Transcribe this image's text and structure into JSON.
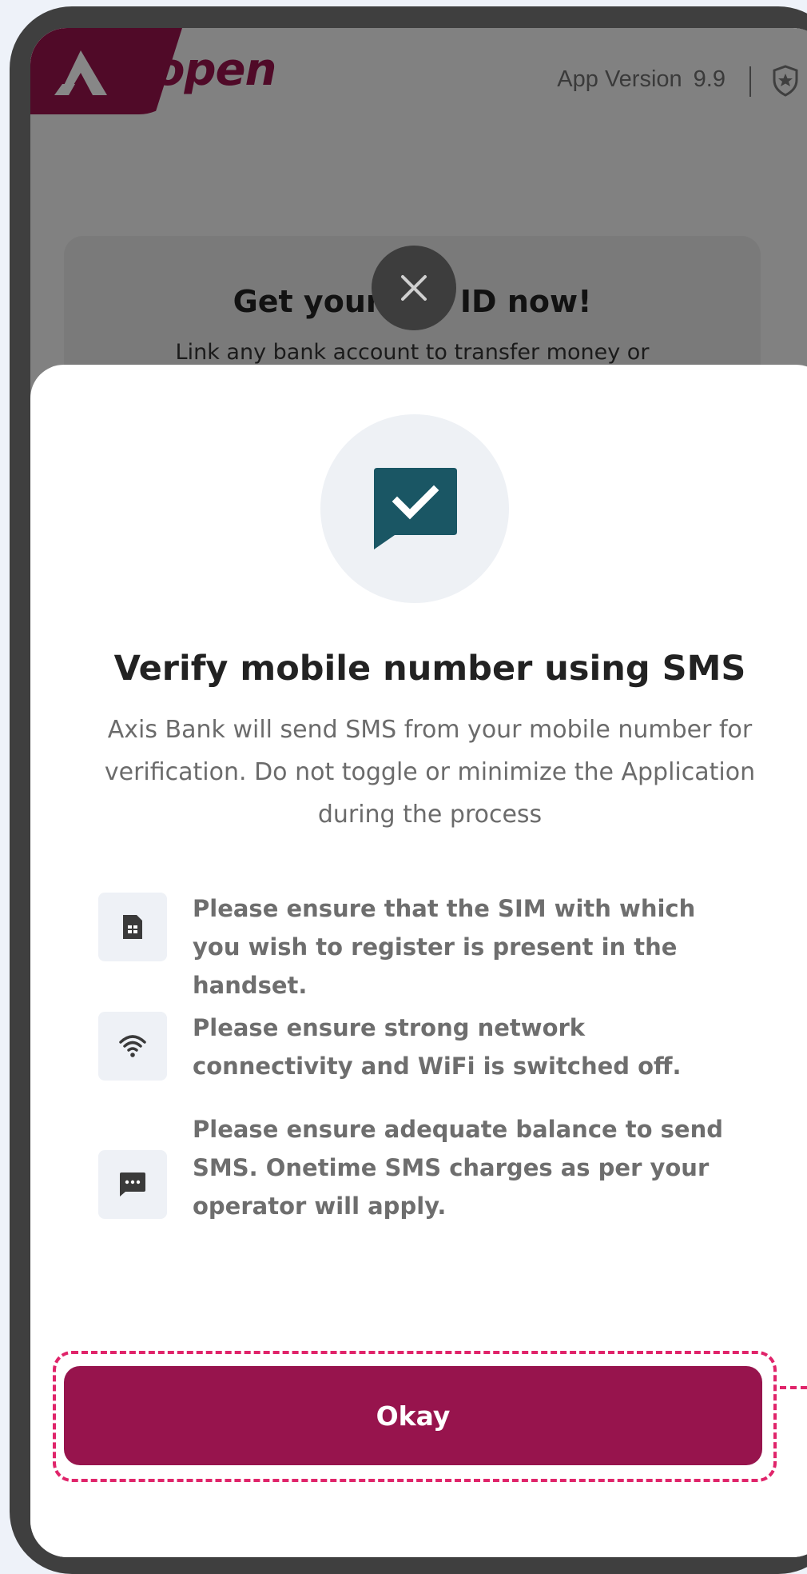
{
  "header": {
    "brand": "open",
    "app_version_label": "App Version",
    "app_version_value": "9.9"
  },
  "background_card": {
    "title": "Get your UPI ID now!",
    "subtitle": "Link any bank account to transfer money or"
  },
  "sheet": {
    "title": "Verify mobile number using SMS",
    "description": "Axis Bank will send SMS from your mobile number for verification. Do not toggle or minimize the Application during the process",
    "items": [
      {
        "icon": "sim-card-icon",
        "text": "Please ensure that the SIM with which you wish to register is present in the handset."
      },
      {
        "icon": "wifi-icon",
        "text": "Please ensure strong network connectivity and WiFi is switched off."
      },
      {
        "icon": "sms-icon",
        "text": "Please ensure adequate balance to send SMS. Onetime SMS charges as per your operator will apply."
      }
    ],
    "okay_label": "Okay"
  },
  "colors": {
    "brand": "#97144d",
    "illustration": "#1a5664",
    "focus_outline": "#e0246a",
    "overlay": "rgba(0,0,0,0.47)"
  }
}
